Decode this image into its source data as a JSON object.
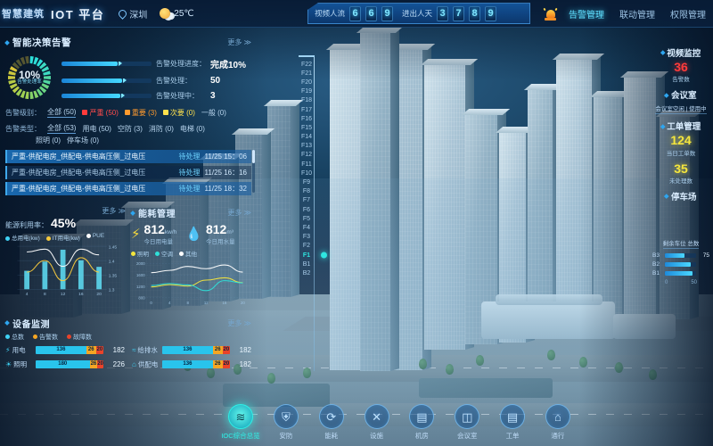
{
  "topbar": {
    "logo_cn": "智慧建筑",
    "logo_en": "IOT 平台",
    "location": "深圳",
    "temperature": "25℃",
    "pin_icon": "location-pin-icon",
    "weather_icon": "sun-cloud-icon",
    "counters": [
      {
        "label": "视频人流",
        "digits": [
          "6",
          "6",
          "9"
        ]
      },
      {
        "label": "进出人天",
        "digits": [
          "3",
          "7",
          "8",
          "9"
        ]
      }
    ],
    "bell_icon": "alarm-bell-icon",
    "tabs": [
      {
        "label": "告警管理",
        "active": true
      },
      {
        "label": "联动管理",
        "active": false
      },
      {
        "label": "权限管理",
        "active": false
      }
    ]
  },
  "alarm_panel": {
    "title": "智能决策告警",
    "more": "更多 ≫",
    "gauge": {
      "percent": "10%",
      "caption": "告警处理率",
      "value": 10
    },
    "bars": [
      {
        "label": "告警处理进度：",
        "value": "完成10%",
        "fill": 62
      },
      {
        "label": "告警处理：",
        "value": "50",
        "fill": 67
      },
      {
        "label": "告警处理中：",
        "value": "3",
        "fill": 65
      }
    ],
    "filter_level_key": "告警级别：",
    "filter_level": [
      {
        "label": "全部 (50)",
        "color": "",
        "underline": true
      },
      {
        "label": "严重 (50)",
        "color": "#ff3b3b"
      },
      {
        "label": "重要 (3)",
        "color": "#ff9a2e"
      },
      {
        "label": "次要 (0)",
        "color": "#ffe14d"
      },
      {
        "label": "一般 (0)",
        "color": "#cfe6fb"
      }
    ],
    "filter_type_key": "告警类型：",
    "filter_type": [
      {
        "label": "全部 (53)",
        "underline": true
      },
      {
        "label": "用电 (50)"
      },
      {
        "label": "空防 (3)"
      },
      {
        "label": "消防 (0)"
      },
      {
        "label": "电梯 (0)"
      },
      {
        "label": "照明 (0)"
      },
      {
        "label": "停车场 (0)"
      }
    ],
    "list": [
      {
        "text": "严重-供配电房_供配电-供电高压侧_过电压",
        "status": "待处理",
        "time": "11/25  15：06",
        "selected": true
      },
      {
        "text": "严重-供配电房_供配电-供电高压侧_过电压",
        "status": "待处理",
        "time": "11/25  16：16",
        "selected": false
      },
      {
        "text": "严重-供配电房_供配电-供电高压侧_过电压",
        "status": "待处理",
        "time": "11/25  18：32",
        "selected": true
      }
    ]
  },
  "pue_panel": {
    "more": "更多 ≫",
    "headline_label": "能源利用率：",
    "headline_value": "45%",
    "legend": [
      {
        "label": "总用电(kw)",
        "color": "#3fd2f5"
      },
      {
        "label": "IT用电(kw)",
        "color": "#f5c93d"
      },
      {
        "label": "PUE",
        "color": "#ffffff"
      }
    ]
  },
  "energy_panel": {
    "title": "能耗管理",
    "more": "更多 ≫",
    "metrics": [
      {
        "icon": "lightning-icon",
        "value": "812",
        "unit": "kw/h",
        "caption": "今日用电量",
        "color": "#f5d83d"
      },
      {
        "icon": "water-drop-icon",
        "value": "812",
        "unit": "m³",
        "caption": "今日用水量",
        "color": "#3fd2f5"
      }
    ],
    "legend": [
      {
        "label": "照明",
        "color": "#f5e63d"
      },
      {
        "label": "空调",
        "color": "#2fe0d8"
      },
      {
        "label": "其他",
        "color": "#ffffff"
      }
    ]
  },
  "monitor_panel": {
    "title": "设备监测",
    "more": "更多 ≫",
    "legend": [
      {
        "label": "总数",
        "color": "#3fd2f5"
      },
      {
        "label": "告警数",
        "color": "#f5a623"
      },
      {
        "label": "故障数",
        "color": "#e8432a"
      }
    ],
    "rows": [
      {
        "icon": "power-icon",
        "name": "用电",
        "seg": [
          "136",
          "26",
          "20"
        ],
        "total": "182"
      },
      {
        "icon": "light-icon",
        "name": "照明",
        "seg": [
          "180",
          "26",
          "20"
        ],
        "total": "226"
      },
      {
        "icon": "water-icon",
        "name": "给排水",
        "seg": [
          "136",
          "26",
          "20"
        ],
        "total": "182"
      },
      {
        "icon": "hvac-icon",
        "name": "供配电",
        "seg": [
          "136",
          "26",
          "20"
        ],
        "total": "182"
      }
    ]
  },
  "floor_selector": {
    "floors": [
      "F22",
      "F21",
      "F20",
      "F19",
      "F18",
      "F17",
      "F16",
      "F15",
      "F14",
      "F13",
      "F12",
      "F11",
      "F10",
      "F9",
      "F8",
      "F7",
      "F6",
      "F5",
      "F4",
      "F3",
      "F2",
      "F1",
      "B1",
      "B2"
    ],
    "selected": "F1"
  },
  "right_panel": {
    "sections": [
      {
        "title": "视频监控",
        "number": "36",
        "number_color": "red",
        "caption": "告警数",
        "chip": ""
      },
      {
        "title": "会议室",
        "number": "",
        "number_color": "",
        "caption": "",
        "chip": "会议室空闲 | 使用中"
      },
      {
        "title": "工单管理",
        "number": "124",
        "number_color": "ylw",
        "caption": "当日工单数",
        "chip": ""
      },
      {
        "title": "",
        "number": "35",
        "number_color": "ylw",
        "caption": "未处理数",
        "chip": ""
      },
      {
        "title": "停车场",
        "number": "",
        "number_color": "",
        "caption": "",
        "chip": "剩余车位 总数"
      }
    ],
    "parking": {
      "levels": [
        {
          "label": "B3",
          "value": "75",
          "fill": 62
        },
        {
          "label": "B2",
          "value": "",
          "fill": 82
        },
        {
          "label": "B1",
          "value": "",
          "fill": 88
        }
      ],
      "axis": [
        "0",
        "50"
      ]
    }
  },
  "bottom_nav": [
    {
      "label": "IOC综合总览",
      "icon": "layers-icon",
      "glyph": "≋",
      "active": true
    },
    {
      "label": "安防",
      "icon": "shield-icon",
      "glyph": "⛨",
      "active": false
    },
    {
      "label": "能耗",
      "icon": "recycle-icon",
      "glyph": "⟳",
      "active": false
    },
    {
      "label": "设施",
      "icon": "tools-icon",
      "glyph": "✕",
      "active": false
    },
    {
      "label": "机房",
      "icon": "server-icon",
      "glyph": "▤",
      "active": false
    },
    {
      "label": "会议室",
      "icon": "meeting-icon",
      "glyph": "◫",
      "active": false
    },
    {
      "label": "工单",
      "icon": "ticket-icon",
      "glyph": "▤",
      "active": false
    },
    {
      "label": "通行",
      "icon": "gate-icon",
      "glyph": "⌂",
      "active": false
    }
  ],
  "chart_data": [
    {
      "type": "bar",
      "title": "能源利用率 45%",
      "categories": [
        "4",
        "8",
        "12",
        "16",
        "20"
      ],
      "series": [
        {
          "name": "总用电(kw)",
          "values": [
            140,
            210,
            300,
            220,
            170
          ],
          "type": "bar",
          "color": "#3fd2f5"
        },
        {
          "name": "IT用电(kw)",
          "values": [
            1.36,
            1.4,
            1.33,
            1.41,
            1.36
          ],
          "type": "line",
          "color": "#f5c93d"
        },
        {
          "name": "PUE",
          "values": [
            1.43,
            1.44,
            1.38,
            1.44,
            1.42
          ],
          "type": "line",
          "color": "#ffffff"
        }
      ],
      "ylabel": "PUE",
      "yticks": [
        "1.45",
        "1.4",
        "1.35",
        "1.3"
      ],
      "ylim": [
        1.3,
        1.45
      ],
      "xlabel": "",
      "grid": true,
      "legend_position": "top"
    },
    {
      "type": "line",
      "title": "能耗管理",
      "x": [
        0,
        4,
        8,
        12,
        16,
        20
      ],
      "series": [
        {
          "name": "照明",
          "color": "#f5e63d",
          "values": [
            1180,
            1260,
            1210,
            1420,
            1500,
            1330
          ]
        },
        {
          "name": "空调",
          "color": "#2fe0d8",
          "values": [
            1230,
            1300,
            1250,
            1050,
            1400,
            1320
          ]
        },
        {
          "name": "其他",
          "color": "#ffffff",
          "values": [
            1680,
            1760,
            1900,
            1820,
            1950,
            1700
          ]
        }
      ],
      "yticks": [
        "2000",
        "1600",
        "1200",
        "800"
      ],
      "ylim": [
        800,
        2000
      ],
      "xticks": [
        "0",
        "4",
        "8",
        "12",
        "16",
        "20"
      ],
      "grid": true,
      "legend_position": "top"
    }
  ]
}
